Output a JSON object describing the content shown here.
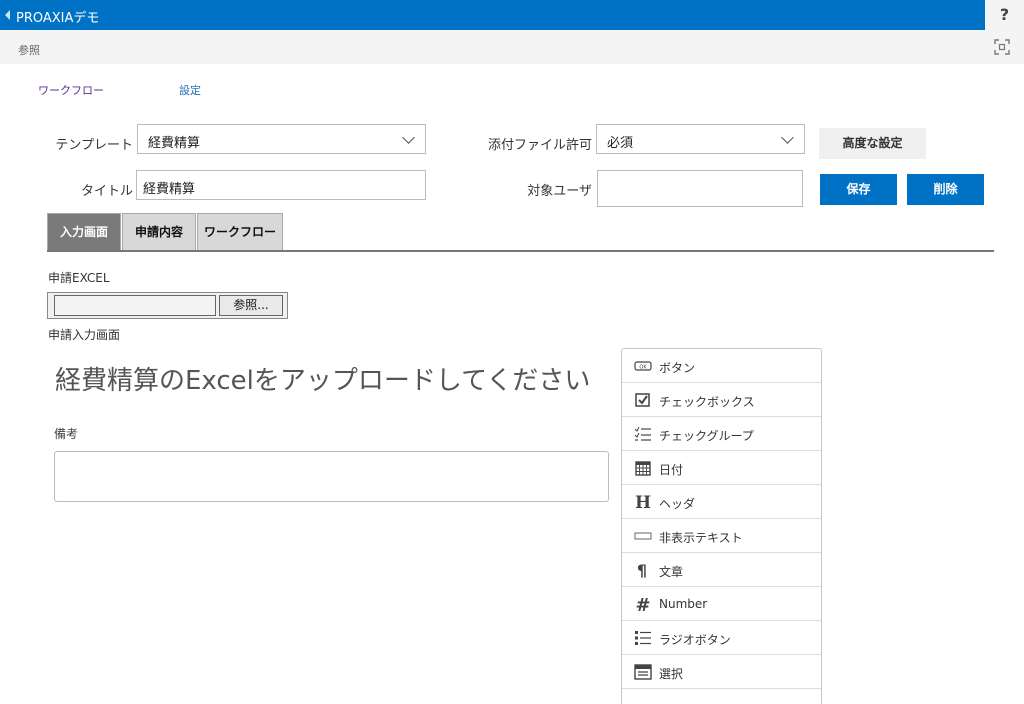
{
  "header": {
    "title": "PROAXIAデモ",
    "help": "?"
  },
  "subbar": {
    "label": "参照"
  },
  "nav": {
    "workflow": "ワークフロー",
    "settings": "設定"
  },
  "form": {
    "template_label": "テンプレート",
    "template_value": "経費精算",
    "title_label": "タイトル",
    "title_value": "経費精算",
    "attach_label": "添付ファイル許可",
    "attach_value": "必須",
    "target_label": "対象ユーザ",
    "target_value": ""
  },
  "buttons": {
    "advanced": "高度な設定",
    "save": "保存",
    "delete": "削除"
  },
  "tabs": [
    {
      "label": "入力画面",
      "active": true
    },
    {
      "label": "申請内容",
      "active": false
    },
    {
      "label": "ワークフロー",
      "active": false
    }
  ],
  "input_screen": {
    "excel_label": "申請EXCEL",
    "browse": "参照...",
    "screen_label": "申請入力画面",
    "heading": "経費精算のExcelをアップロードしてください",
    "notes_label": "備考"
  },
  "toolbox": {
    "items": [
      {
        "label": "ボタン",
        "icon": "button-icon"
      },
      {
        "label": "チェックボックス",
        "icon": "checkbox-icon"
      },
      {
        "label": "チェックグループ",
        "icon": "check-group-icon"
      },
      {
        "label": "日付",
        "icon": "calendar-icon"
      },
      {
        "label": "ヘッダ",
        "icon": "header-icon"
      },
      {
        "label": "非表示テキスト",
        "icon": "hidden-text-icon"
      },
      {
        "label": "文章",
        "icon": "paragraph-icon"
      },
      {
        "label": "Number",
        "icon": "number-icon"
      },
      {
        "label": "ラジオボタン",
        "icon": "radio-list-icon"
      },
      {
        "label": "選択",
        "icon": "select-icon"
      }
    ]
  },
  "colors": {
    "brand": "#0072c6",
    "tab_active": "#7a7a7a",
    "tab_inactive": "#d8d8d8"
  }
}
